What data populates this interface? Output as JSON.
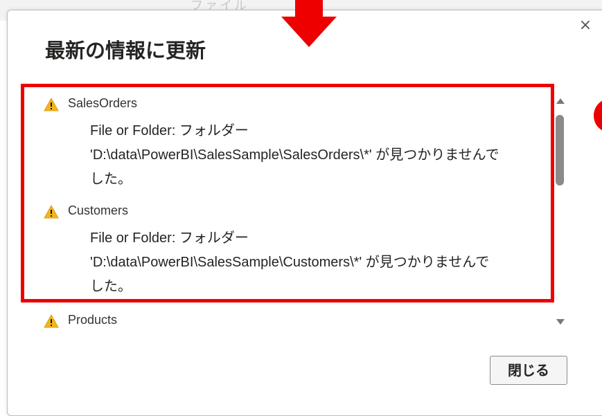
{
  "background": {
    "ghost_text": "ファイル"
  },
  "dialog": {
    "title": "最新の情報に更新",
    "close_glyph": "×",
    "close_button_label": "閉じる",
    "entries": [
      {
        "name": "SalesOrders",
        "line1": "File or Folder: フォルダー",
        "line2": "'D:\\data\\PowerBI\\SalesSample\\SalesOrders\\*' が見つかりませんで",
        "line3": "した。"
      },
      {
        "name": "Customers",
        "line1": "File or Folder: フォルダー",
        "line2": "'D:\\data\\PowerBI\\SalesSample\\Customers\\*' が見つかりませんで",
        "line3": "した。"
      },
      {
        "name": "Products"
      }
    ]
  },
  "annotations": {
    "highlight_color": "#ee0000",
    "arrow_color": "#ee0000"
  },
  "icons": {
    "warning": "warning-icon",
    "close": "close-icon",
    "scroll_up": "scroll-up-icon",
    "scroll_down": "scroll-down-icon",
    "arrow": "down-arrow-icon"
  },
  "colors": {
    "warning_fill": "#f2b51b",
    "text_primary": "#252423",
    "border": "#bdbdbd"
  }
}
